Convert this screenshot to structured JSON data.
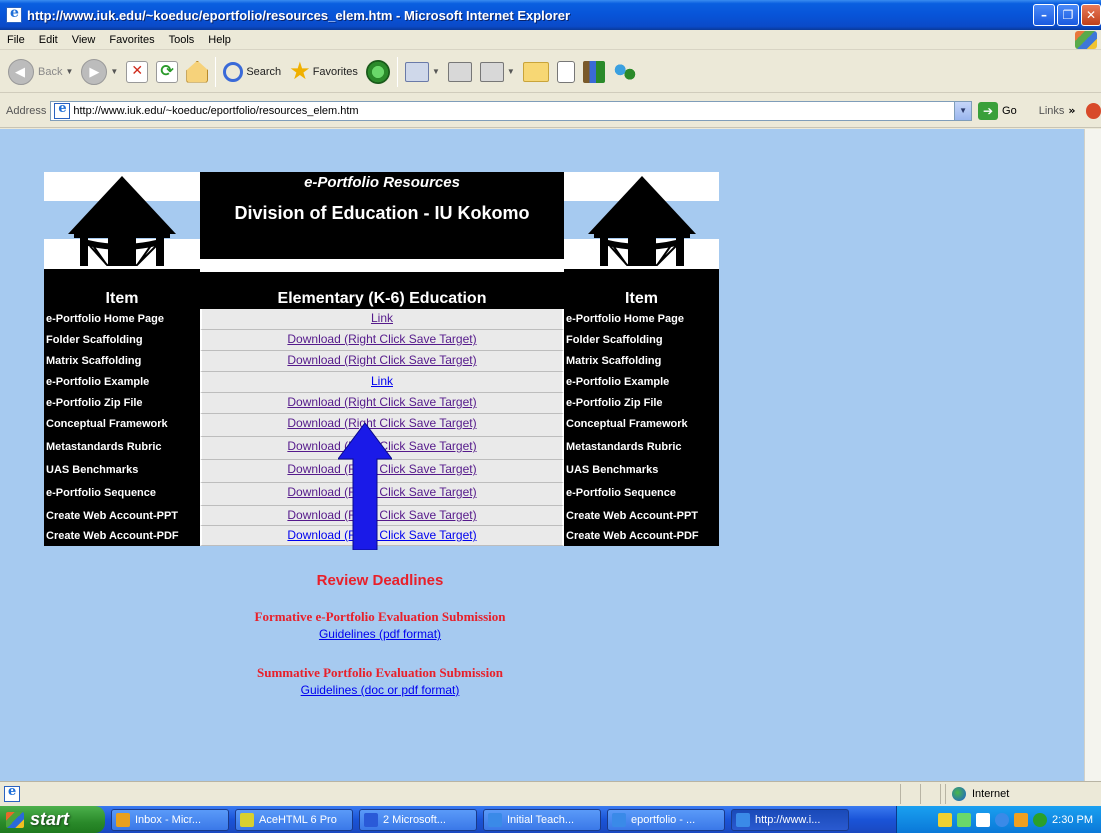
{
  "window": {
    "title": "http://www.iuk.edu/~koeduc/eportfolio/resources_elem.htm - Microsoft Internet Explorer",
    "controls": [
      "minimize",
      "maximize",
      "close"
    ]
  },
  "menu": [
    "File",
    "Edit",
    "View",
    "Favorites",
    "Tools",
    "Help"
  ],
  "toolbar": {
    "back_label": "Back",
    "search_label": "Search",
    "favorites_label": "Favorites"
  },
  "address": {
    "label": "Address",
    "value": "http://www.iuk.edu/~koeduc/eportfolio/resources_elem.htm",
    "go_label": "Go",
    "links_label": "Links"
  },
  "banner": {
    "subtitle": "e-Portfolio Resources",
    "title": "Division of Education - IU Kokomo"
  },
  "table": {
    "headers": [
      "Item",
      "Elementary (K-6) Education",
      "Item"
    ],
    "rows": [
      {
        "left": "e-Portfolio Home Page",
        "link": "Link",
        "right": "e-Portfolio Home Page",
        "visited": true
      },
      {
        "left": "Folder Scaffolding",
        "link": "Download (Right Click Save Target)",
        "right": "Folder Scaffolding",
        "visited": true
      },
      {
        "left": "Matrix Scaffolding",
        "link": "Download (Right Click Save Target)",
        "right": "Matrix Scaffolding",
        "visited": true
      },
      {
        "left": "e-Portfolio Example",
        "link": "Link",
        "right": "e-Portfolio Example",
        "visited": false
      },
      {
        "left": "e-Portfolio Zip File",
        "link": "Download (Right Click Save Target)",
        "right": "e-Portfolio Zip File",
        "visited": true
      },
      {
        "left": "Conceptual Framework",
        "link": "Download (Right Click Save Target)",
        "right": "Conceptual Framework",
        "visited": true
      },
      {
        "left": "Metastandards Rubric",
        "link": "Download (Right Click Save Target)",
        "right": "Metastandards Rubric",
        "visited": true
      },
      {
        "left": "UAS Benchmarks",
        "link": "Download (Right Click Save Target)",
        "right": "UAS Benchmarks",
        "visited": true
      },
      {
        "left": "e-Portfolio Sequence",
        "link": "Download (Right Click Save Target)",
        "right": "e-Portfolio Sequence",
        "visited": true
      },
      {
        "left": "Create Web Account-PPT",
        "link": "Download (Right Click Save Target)",
        "right": "Create Web Account-PPT",
        "visited": true
      },
      {
        "left": "Create Web Account-PDF",
        "link": "Download (Right Click Save Target)",
        "right": "Create Web Account-PDF",
        "visited": false
      }
    ]
  },
  "review": {
    "title": "Review Deadlines",
    "formative_title": "Formative e-Portfolio Evaluation Submission",
    "formative_link": "Guidelines (pdf format)",
    "summative_title": "Summative Portfolio Evaluation Submission",
    "summative_link": "Guidelines (doc or pdf format)"
  },
  "status": {
    "zone": "Internet"
  },
  "taskbar": {
    "start_label": "start",
    "tasks": [
      {
        "label": "Inbox - Micr...",
        "color": "#e8a020"
      },
      {
        "label": "AceHTML 6 Pro",
        "color": "#d8d030"
      },
      {
        "label": "2 Microsoft...",
        "color": "#2a5ad8"
      },
      {
        "label": "Initial Teach...",
        "color": "#3a8ae8"
      },
      {
        "label": "eportfolio - ...",
        "color": "#3a8ae8"
      },
      {
        "label": "http://www.i...",
        "color": "#3a8ae8"
      }
    ],
    "clock": "2:30 PM"
  },
  "colors": {
    "page_bg": "#a6caf0",
    "table_black": "#000000",
    "link_visited": "#551a8b",
    "link_unvisited": "#0000ee",
    "review_red": "#e8202a",
    "arrow_blue": "#1a1ae8"
  }
}
